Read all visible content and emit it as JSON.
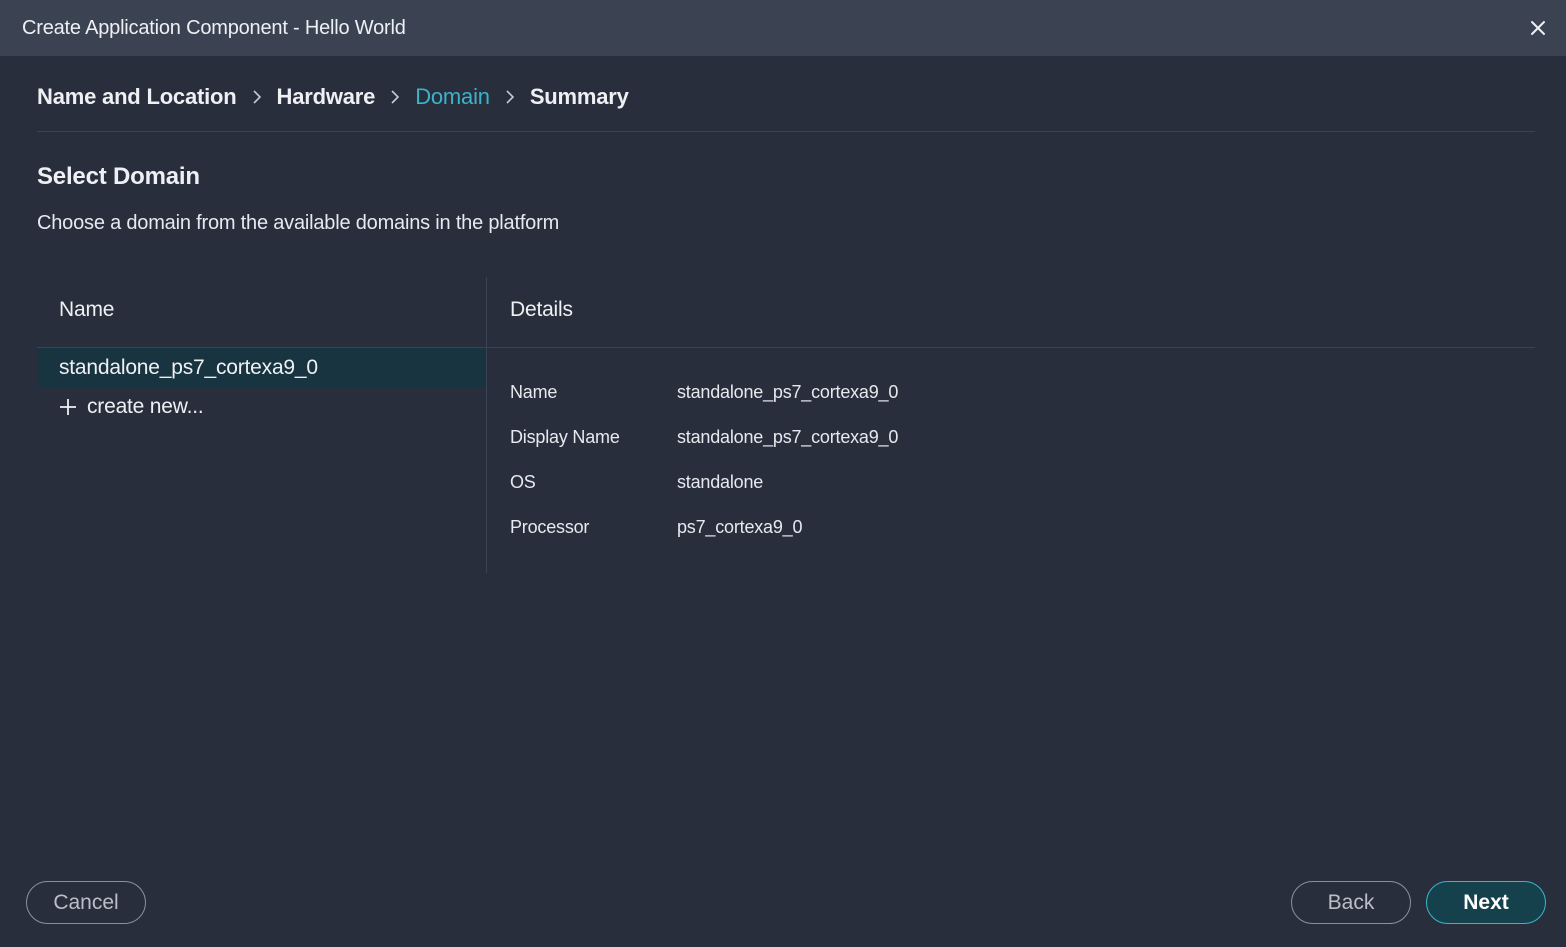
{
  "window": {
    "title": "Create Application Component - Hello World",
    "close_icon": "close-icon"
  },
  "breadcrumb": {
    "items": [
      {
        "label": "Name and Location",
        "active": false
      },
      {
        "label": "Hardware",
        "active": false
      },
      {
        "label": "Domain",
        "active": true
      },
      {
        "label": "Summary",
        "active": false
      }
    ],
    "separator_icon": "chevron-right-icon"
  },
  "section": {
    "title": "Select Domain",
    "description": "Choose a domain from the available domains in the platform"
  },
  "table": {
    "name_header": "Name",
    "details_header": "Details",
    "domains": [
      {
        "name": "standalone_ps7_cortexa9_0",
        "selected": true
      }
    ],
    "create_new_label": "create new...",
    "create_new_icon": "plus-icon"
  },
  "details": {
    "rows": [
      {
        "label": "Name",
        "value": "standalone_ps7_cortexa9_0"
      },
      {
        "label": "Display Name",
        "value": "standalone_ps7_cortexa9_0"
      },
      {
        "label": "OS",
        "value": "standalone"
      },
      {
        "label": "Processor",
        "value": "ps7_cortexa9_0"
      }
    ]
  },
  "footer": {
    "cancel_label": "Cancel",
    "back_label": "Back",
    "next_label": "Next"
  },
  "colors": {
    "background": "#282e3c",
    "titlebar": "#3b4252",
    "accent": "#3ab4c8",
    "selected_row": "#183441"
  }
}
